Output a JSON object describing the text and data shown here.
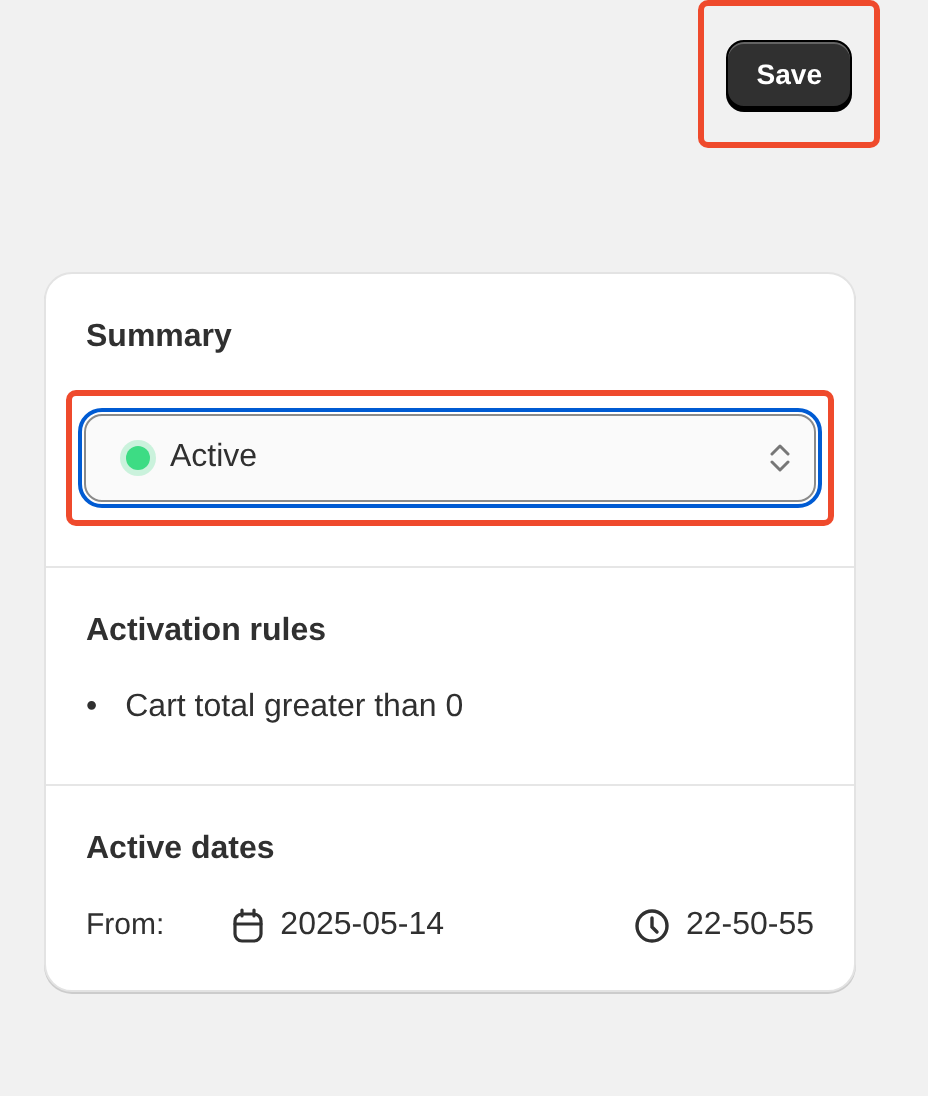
{
  "save_button": {
    "label": "Save",
    "highlighted": true
  },
  "summary": {
    "title": "Summary",
    "status": {
      "value": "Active",
      "color": "#3ddc84",
      "highlighted": true,
      "focused": true
    }
  },
  "activation_rules": {
    "title": "Activation rules",
    "rules": [
      {
        "bullet": "•",
        "text": "Cart total greater than 0"
      }
    ]
  },
  "active_dates": {
    "title": "Active dates",
    "from_label": "From:",
    "date": "2025-05-14",
    "time": "22-50-55"
  }
}
